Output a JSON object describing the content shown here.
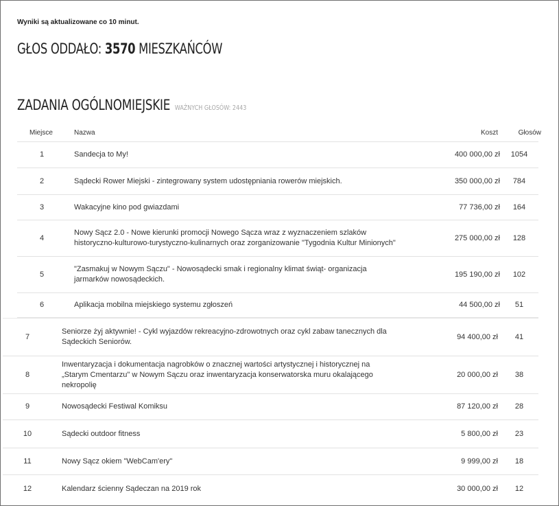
{
  "update_note": "Wyniki są aktualizowane co 10 minut.",
  "votes_heading": {
    "prefix": "GŁOS ODDAŁO:",
    "count": "3570",
    "suffix": "MIESZKAŃCÓW"
  },
  "section": {
    "title": "ZADANIA OGÓLNOMIEJSKIE",
    "valid_label": "WAŻNYCH GŁOSÓW:",
    "valid_count": "2443"
  },
  "table": {
    "headers": {
      "place": "Miejsce",
      "name": "Nazwa",
      "cost": "Koszt",
      "votes": "Głosów"
    },
    "rows": [
      {
        "place": "1",
        "name": "Sandecja to My!",
        "cost": "400 000,00 zł",
        "votes": "1054"
      },
      {
        "place": "2",
        "name": "Sądecki Rower Miejski - zintegrowany system udostępniania rowerów miejskich.",
        "cost": "350 000,00 zł",
        "votes": "784"
      },
      {
        "place": "3",
        "name": "Wakacyjne kino pod gwiazdami",
        "cost": "77 736,00 zł",
        "votes": "164"
      },
      {
        "place": "4",
        "name": "Nowy Sącz 2.0 - Nowe kierunki promocji Nowego Sącza wraz z wyznaczeniem szlaków historyczno-kulturowo-turystyczno-kulinarnych oraz zorganizowanie \"Tygodnia Kultur Minionych\"",
        "cost": "275 000,00 zł",
        "votes": "128"
      },
      {
        "place": "5",
        "name": "\"Zasmakuj w Nowym Sączu\" - Nowosądecki smak i regionalny klimat świąt- organizacja jarmarków nowosądeckich.",
        "cost": "195 190,00 zł",
        "votes": "102"
      },
      {
        "place": "6",
        "name": "Aplikacja mobilna miejskiego systemu zgłoszeń",
        "cost": "44 500,00 zł",
        "votes": "51"
      },
      {
        "place": "7",
        "name": "Seniorze żyj aktywnie! - Cykl wyjazdów rekreacyjno-zdrowotnych oraz cykl zabaw tanecznych dla Sądeckich Seniorów.",
        "cost": "94 400,00 zł",
        "votes": "41"
      },
      {
        "place": "8",
        "name": "Inwentaryzacja i dokumentacja nagrobków o znacznej wartości artystycznej i historycznej na „Starym Cmentarzu\" w Nowym Sączu oraz inwentaryzacja konserwatorska muru okalającego nekropolię",
        "cost": "20 000,00 zł",
        "votes": "38"
      },
      {
        "place": "9",
        "name": "Nowosądecki Festiwal Komiksu",
        "cost": "87 120,00 zł",
        "votes": "28"
      },
      {
        "place": "10",
        "name": "Sądecki outdoor fitness",
        "cost": "5 800,00 zł",
        "votes": "23"
      },
      {
        "place": "11",
        "name": "Nowy Sącz okiem \"WebCam'ery\"",
        "cost": "9 999,00 zł",
        "votes": "18"
      },
      {
        "place": "12",
        "name": "Kalendarz ścienny Sądeczan na 2019 rok",
        "cost": "30 000,00 zł",
        "votes": "12"
      }
    ]
  }
}
